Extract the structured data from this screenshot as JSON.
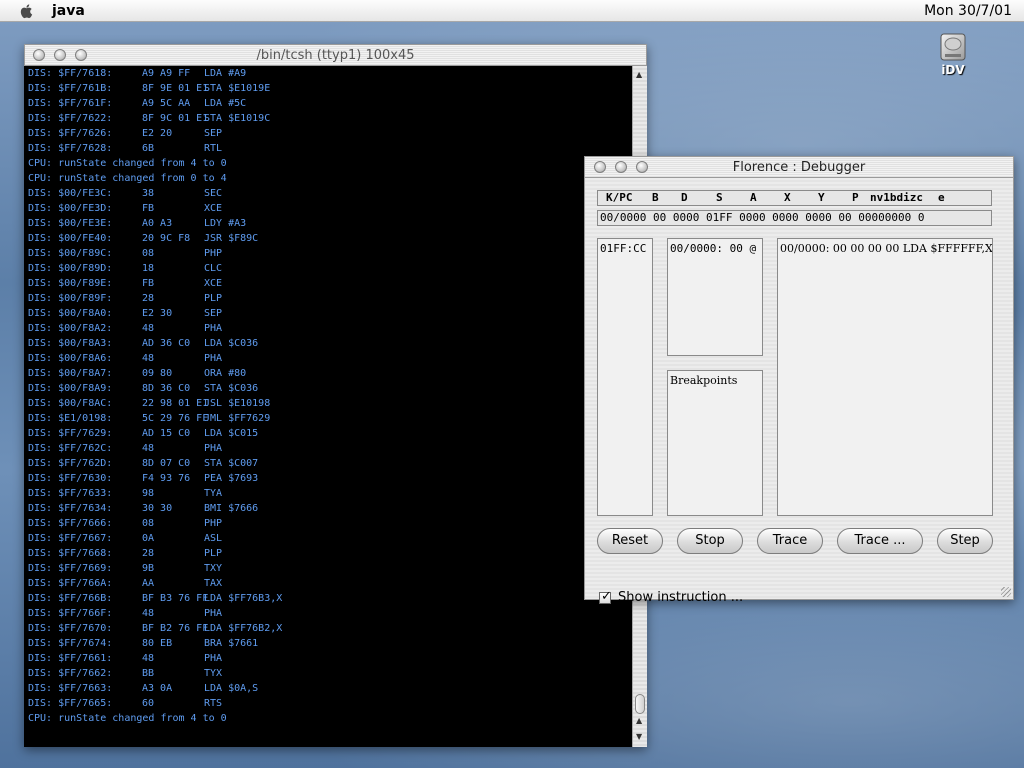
{
  "menubar": {
    "app_name": "java",
    "clock": "Mon 30/7/01"
  },
  "desktop": {
    "disk_label": "iDV"
  },
  "terminal": {
    "title": "/bin/tcsh (ttyp1) 100x45",
    "lines": [
      {
        "a": "DIS: $FF/7618:",
        "b": "A9 A9 FF",
        "c": "LDA #A9"
      },
      {
        "a": "DIS: $FF/761B:",
        "b": "8F 9E 01 E1",
        "c": "STA $E1019E"
      },
      {
        "a": "DIS: $FF/761F:",
        "b": "A9 5C AA",
        "c": "LDA #5C"
      },
      {
        "a": "DIS: $FF/7622:",
        "b": "8F 9C 01 E1",
        "c": "STA $E1019C"
      },
      {
        "a": "DIS: $FF/7626:",
        "b": "E2 20",
        "c": "SEP"
      },
      {
        "a": "DIS: $FF/7628:",
        "b": "6B",
        "c": "RTL"
      },
      {
        "a": "CPU: runState changed from 4 to 0",
        "b": "",
        "c": ""
      },
      {
        "a": "CPU: runState changed from 0 to 4",
        "b": "",
        "c": ""
      },
      {
        "a": "DIS: $00/FE3C:",
        "b": "38",
        "c": "SEC"
      },
      {
        "a": "DIS: $00/FE3D:",
        "b": "FB",
        "c": "XCE"
      },
      {
        "a": "DIS: $00/FE3E:",
        "b": "A0 A3",
        "c": "LDY #A3"
      },
      {
        "a": "DIS: $00/FE40:",
        "b": "20 9C F8",
        "c": "JSR $F89C"
      },
      {
        "a": "DIS: $00/F89C:",
        "b": "08",
        "c": "PHP"
      },
      {
        "a": "DIS: $00/F89D:",
        "b": "18",
        "c": "CLC"
      },
      {
        "a": "DIS: $00/F89E:",
        "b": "FB",
        "c": "XCE"
      },
      {
        "a": "DIS: $00/F89F:",
        "b": "28",
        "c": "PLP"
      },
      {
        "a": "DIS: $00/F8A0:",
        "b": "E2 30",
        "c": "SEP"
      },
      {
        "a": "DIS: $00/F8A2:",
        "b": "48",
        "c": "PHA"
      },
      {
        "a": "DIS: $00/F8A3:",
        "b": "AD 36 C0",
        "c": "LDA $C036"
      },
      {
        "a": "DIS: $00/F8A6:",
        "b": "48",
        "c": "PHA"
      },
      {
        "a": "DIS: $00/F8A7:",
        "b": "09 80",
        "c": "ORA #80"
      },
      {
        "a": "DIS: $00/F8A9:",
        "b": "8D 36 C0",
        "c": "STA $C036"
      },
      {
        "a": "DIS: $00/F8AC:",
        "b": "22 98 01 E1",
        "c": "JSL $E10198"
      },
      {
        "a": "DIS: $E1/0198:",
        "b": "5C 29 76 FF",
        "c": "JML $FF7629"
      },
      {
        "a": "DIS: $FF/7629:",
        "b": "AD 15 C0",
        "c": "LDA $C015"
      },
      {
        "a": "DIS: $FF/762C:",
        "b": "48",
        "c": "PHA"
      },
      {
        "a": "DIS: $FF/762D:",
        "b": "8D 07 C0",
        "c": "STA $C007"
      },
      {
        "a": "DIS: $FF/7630:",
        "b": "F4 93 76",
        "c": "PEA $7693"
      },
      {
        "a": "DIS: $FF/7633:",
        "b": "98",
        "c": "TYA"
      },
      {
        "a": "DIS: $FF/7634:",
        "b": "30 30",
        "c": "BMI $7666"
      },
      {
        "a": "DIS: $FF/7666:",
        "b": "08",
        "c": "PHP"
      },
      {
        "a": "DIS: $FF/7667:",
        "b": "0A",
        "c": "ASL"
      },
      {
        "a": "DIS: $FF/7668:",
        "b": "28",
        "c": "PLP"
      },
      {
        "a": "DIS: $FF/7669:",
        "b": "9B",
        "c": "TXY"
      },
      {
        "a": "DIS: $FF/766A:",
        "b": "AA",
        "c": "TAX"
      },
      {
        "a": "DIS: $FF/766B:",
        "b": "BF B3 76 FF",
        "c": "LDA $FF76B3,X"
      },
      {
        "a": "DIS: $FF/766F:",
        "b": "48",
        "c": "PHA"
      },
      {
        "a": "DIS: $FF/7670:",
        "b": "BF B2 76 FF",
        "c": "LDA $FF76B2,X"
      },
      {
        "a": "DIS: $FF/7674:",
        "b": "80 EB",
        "c": "BRA $7661"
      },
      {
        "a": "DIS: $FF/7661:",
        "b": "48",
        "c": "PHA"
      },
      {
        "a": "DIS: $FF/7662:",
        "b": "BB",
        "c": "TYX"
      },
      {
        "a": "DIS: $FF/7663:",
        "b": "A3 0A",
        "c": "LDA $0A,S"
      },
      {
        "a": "DIS: $FF/7665:",
        "b": "60",
        "c": "RTS"
      },
      {
        "a": "CPU: runState changed from 4 to 0",
        "b": "",
        "c": ""
      }
    ]
  },
  "debugger": {
    "title": "Florence : Debugger",
    "reg_headers": [
      "K/PC",
      "B",
      "D",
      "S",
      "A",
      "X",
      "Y",
      "P",
      "nv1bdizc",
      "e"
    ],
    "reg_values": "00/0000 00 0000 01FF 0000 0000 0000 00 00000000 0",
    "stack_text": "01FF:CC",
    "memory_text": "00/0000: 00 @",
    "breakpoints_label": "Breakpoints",
    "disasm_text": "00/0000: 00 00 00 00  LDA $FFFFFF,X",
    "buttons": {
      "reset": "Reset",
      "stop": "Stop",
      "trace": "Trace",
      "trace_more": "Trace ...",
      "step": "Step"
    },
    "show_instruction_label": "Show instruction ...",
    "show_instruction_checked": true
  }
}
